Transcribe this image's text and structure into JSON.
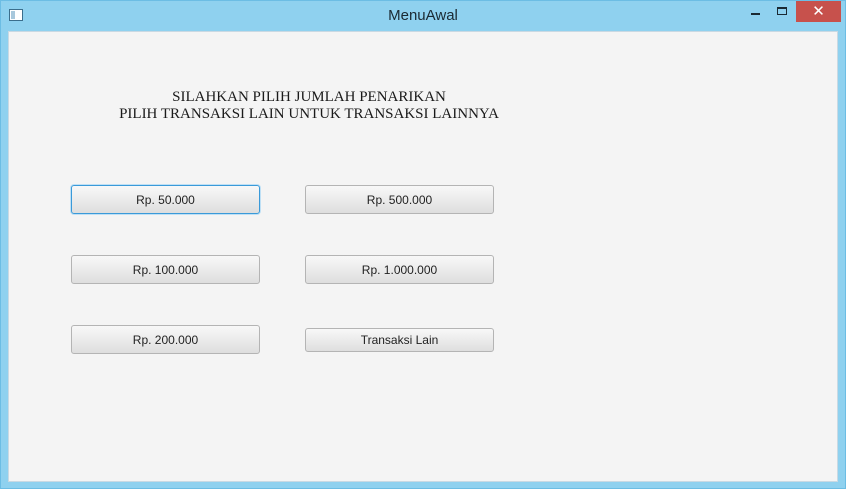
{
  "window": {
    "title": "MenuAwal",
    "close_glyph": "✕",
    "icons": [
      "app-window-icon",
      "minimize-icon",
      "maximize-icon",
      "close-icon"
    ]
  },
  "instructions": {
    "line1": "SILAHKAN PILIH JUMLAH PENARIKAN",
    "line2": "PILIH TRANSAKSI LAIN UNTUK TRANSAKSI LAINNYA"
  },
  "buttons": {
    "b50k": "Rp. 50.000",
    "b100k": "Rp. 100.000",
    "b200k": "Rp. 200.000",
    "b500k": "Rp. 500.000",
    "b1m": "Rp. 1.000.000",
    "other": "Transaksi Lain"
  },
  "colors": {
    "titlebar": "#8fd1ef",
    "close_button": "#c7514c",
    "focus_border": "#3a9ad9",
    "content_bg": "#f4f4f4"
  }
}
